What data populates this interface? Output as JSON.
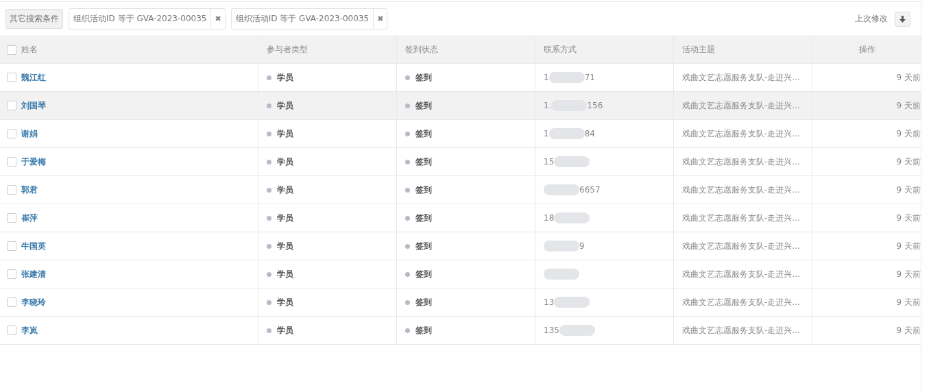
{
  "toolbar": {
    "more_button": "其它搜索条件",
    "filters": [
      {
        "label": "组织活动ID 等于 GVA-2023-00035",
        "remove": "✖"
      },
      {
        "label": "组织活动ID 等于 GVA-2023-00035",
        "remove": "✖"
      }
    ],
    "sort_label": "上次修改"
  },
  "table": {
    "columns": [
      "姓名",
      "参与者类型",
      "签到状态",
      "联系方式",
      "活动主题",
      "操作"
    ],
    "header_checked": false,
    "rows": [
      {
        "name": "魏江红",
        "type": "学员",
        "status": "签到",
        "phone_start": "1",
        "phone_end": "71",
        "topic": "戏曲文艺志愿服务支队-走进兴…",
        "time": "9 天前",
        "checked": false,
        "hovered": false
      },
      {
        "name": "刘国琴",
        "type": "学员",
        "status": "签到",
        "phone_start": "1.",
        "phone_end": "156",
        "topic": "戏曲文艺志愿服务支队-走进兴…",
        "time": "9 天前",
        "checked": false,
        "hovered": true
      },
      {
        "name": "谢娟",
        "type": "学员",
        "status": "签到",
        "phone_start": "1",
        "phone_end": "84",
        "topic": "戏曲文艺志愿服务支队-走进兴…",
        "time": "9 天前",
        "checked": false,
        "hovered": false
      },
      {
        "name": "于爱梅",
        "type": "学员",
        "status": "签到",
        "phone_start": "15",
        "topic": "戏曲文艺志愿服务支队-走进兴…",
        "time": "9 天前",
        "checked": false,
        "hovered": false
      },
      {
        "name": "郭君",
        "type": "学员",
        "status": "签到",
        "phone_end": "6657",
        "topic": "戏曲文艺志愿服务支队-走进兴…",
        "time": "9 天前",
        "checked": false,
        "hovered": false
      },
      {
        "name": "崔萍",
        "type": "学员",
        "status": "签到",
        "phone_start": "18",
        "topic": "戏曲文艺志愿服务支队-走进兴…",
        "time": "9 天前",
        "checked": false,
        "hovered": false
      },
      {
        "name": "牛国英",
        "type": "学员",
        "status": "签到",
        "phone_end": "9",
        "topic": "戏曲文艺志愿服务支队-走进兴…",
        "time": "9 天前",
        "checked": false,
        "hovered": false
      },
      {
        "name": "张建清",
        "type": "学员",
        "status": "签到",
        "topic": "戏曲文艺志愿服务支队-走进兴…",
        "time": "9 天前",
        "checked": false,
        "hovered": false
      },
      {
        "name": "李晓玲",
        "type": "学员",
        "status": "签到",
        "phone_start": "13",
        "topic": "戏曲文艺志愿服务支队-走进兴…",
        "time": "9 天前",
        "checked": false,
        "hovered": false
      },
      {
        "name": "李岚",
        "type": "学员",
        "status": "签到",
        "phone_start": "135",
        "topic": "戏曲文艺志愿服务支队-走进兴…",
        "time": "9 天前",
        "checked": false,
        "hovered": false
      }
    ]
  }
}
